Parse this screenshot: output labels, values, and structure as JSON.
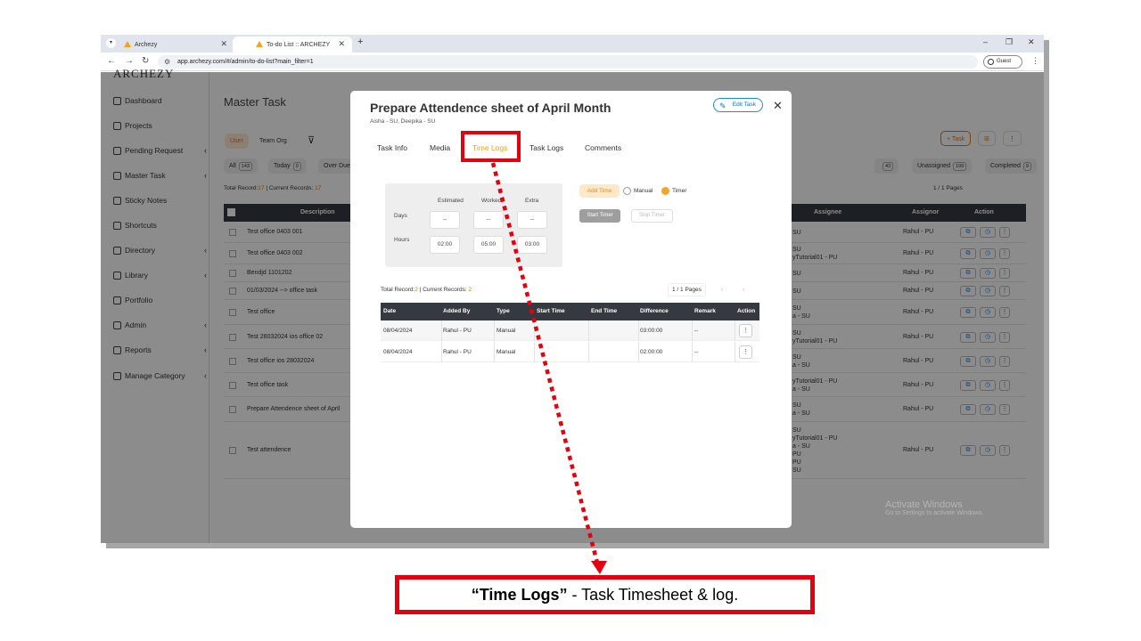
{
  "browser": {
    "tabs": [
      {
        "title": "Archezy"
      },
      {
        "title": "To-do List :: ARCHEZY"
      }
    ],
    "url": "app.archezy.com/#/admin/to-do-list?main_filter=1",
    "profile": "Guest"
  },
  "sidebar": {
    "logo": "ARCHEZY",
    "items": [
      {
        "label": "Dashboard",
        "icon": "home-icon",
        "chevron": false
      },
      {
        "label": "Projects",
        "icon": "clipboard-icon",
        "chevron": false
      },
      {
        "label": "Pending Request",
        "icon": "clipboard-clock-icon",
        "chevron": true
      },
      {
        "label": "Master Task",
        "icon": "list-icon",
        "chevron": true
      },
      {
        "label": "Sticky Notes",
        "icon": "note-icon",
        "chevron": false
      },
      {
        "label": "Shortcuts",
        "icon": "shortcut-icon",
        "chevron": false
      },
      {
        "label": "Directory",
        "icon": "book-icon",
        "chevron": true
      },
      {
        "label": "Library",
        "icon": "library-icon",
        "chevron": true
      },
      {
        "label": "Portfolio",
        "icon": "image-icon",
        "chevron": false
      },
      {
        "label": "Admin",
        "icon": "admin-icon",
        "chevron": true
      },
      {
        "label": "Reports",
        "icon": "report-icon",
        "chevron": true
      },
      {
        "label": "Manage Category",
        "icon": "category-icon",
        "chevron": true
      }
    ]
  },
  "main": {
    "title": "Master Task",
    "view_toggle": [
      "User",
      "Team",
      "Org"
    ],
    "filters": [
      {
        "label": "All",
        "count": "143"
      },
      {
        "label": "Today",
        "count": "0"
      },
      {
        "label": "Over Due",
        "count": ""
      }
    ],
    "right_filters": [
      {
        "label": "",
        "count": "43"
      },
      {
        "label": "Unassigned",
        "count": "199"
      },
      {
        "label": "Completed",
        "count": "9"
      }
    ],
    "add_task": "+ Task",
    "records_prefix": "Total Record:",
    "records_total": "17",
    "records_mid": " | Current Records: ",
    "records_current": "17",
    "pages": "1 / 1 Pages",
    "columns": [
      "Description",
      "Assignee",
      "Assignor",
      "Action"
    ],
    "rows": [
      {
        "description": "Test office 0403 001",
        "assignee": "SU",
        "assignor": "Rahul - PU"
      },
      {
        "description": "Test office 0403 002",
        "assignee": "SU\nyTutorial01 - PU",
        "assignor": "Rahul - PU"
      },
      {
        "description": "Bendjd 1101202",
        "assignee": "SU",
        "assignor": "Rahul - PU"
      },
      {
        "description": "01/03/2024 --> office task",
        "assignee": "SU",
        "assignor": "Rahul - PU"
      },
      {
        "description": "Test office",
        "assignee": "SU\na - SU",
        "assignor": "Rahul - PU"
      },
      {
        "description": "Test 28032024 ios office 02",
        "assignee": "SU\nyTutorial01 - PU",
        "assignor": "Rahul - PU"
      },
      {
        "description": "Test office ios 28032024",
        "assignee": "SU\na - SU",
        "assignor": "Rahul - PU"
      },
      {
        "description": "Test office task",
        "assignee": "yTutorial01 - PU\na - SU",
        "assignor": "Rahul - PU"
      },
      {
        "description": "Prepare Attendence sheet of April",
        "assignee": "SU\na - SU",
        "assignor": "Rahul - PU"
      },
      {
        "description": "Test attendence",
        "assignee": "SU\nyTutorial01 - PU\na - SU\nPU\nPU\nSU",
        "assignor": "Rahul - PU"
      }
    ]
  },
  "modal": {
    "title": "Prepare Attendence sheet of April Month",
    "subtitle": "Aisha - SU, Deepika - SU",
    "edit_label": "Edit Task",
    "tabs": [
      "Task Info",
      "Media",
      "Time Logs",
      "Task Logs",
      "Comments"
    ],
    "active_tab": "Time Logs",
    "time_summary": {
      "headers": [
        "Estimated",
        "Worked",
        "Extra"
      ],
      "days_label": "Days",
      "hours_label": "Hours",
      "days": [
        "--",
        "--",
        "--"
      ],
      "hours": [
        "02:00",
        "05:00",
        "03:00"
      ]
    },
    "add_time_label": "Add Time",
    "mode_options": [
      "Manual",
      "Timer"
    ],
    "selected_mode": "Timer",
    "start_timer": "Start Timer",
    "stop_timer": "Stop Timer",
    "records_prefix": "Total Record:",
    "records_total": "2",
    "records_mid": " | Current Records: ",
    "records_current": "2",
    "pages": "1 / 1 Pages",
    "log_columns": [
      "Date",
      "Added By",
      "Type",
      "Start Time",
      "End Time",
      "Difference",
      "Remark",
      "Action"
    ],
    "logs": [
      {
        "date": "08/04/2024",
        "added_by": "Rahul - PU",
        "type": "Manual",
        "start": "",
        "end": "",
        "difference": "03:00:00",
        "remark": "--"
      },
      {
        "date": "08/04/2024",
        "added_by": "Rahul - PU",
        "type": "Manual",
        "start": "",
        "end": "",
        "difference": "02:00:00",
        "remark": "--"
      }
    ]
  },
  "watermark": {
    "line1": "Activate Windows",
    "line2": "Go to Settings to activate Windows."
  },
  "callout": {
    "highlight": "“Time Logs”",
    "text": " - Task Timesheet & log."
  },
  "colors": {
    "accent": "#f0a020",
    "callout": "#e3000f",
    "table_head": "#343a40"
  }
}
